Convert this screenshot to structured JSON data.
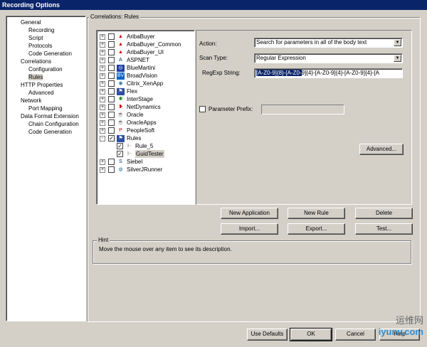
{
  "window": {
    "title": "Recording Options"
  },
  "nav": [
    {
      "label": "General",
      "level": 1
    },
    {
      "label": "Recording",
      "level": 2
    },
    {
      "label": "Script",
      "level": 2
    },
    {
      "label": "Protocols",
      "level": 2
    },
    {
      "label": "Code Generation",
      "level": 2
    },
    {
      "label": "Correlations",
      "level": 1
    },
    {
      "label": "Configuration",
      "level": 2
    },
    {
      "label": "Rules",
      "level": 2,
      "selected": true
    },
    {
      "label": "HTTP Properties",
      "level": 1
    },
    {
      "label": "Advanced",
      "level": 2
    },
    {
      "label": "Network",
      "level": 1
    },
    {
      "label": "Port Mapping",
      "level": 2
    },
    {
      "label": "Data Format Extension",
      "level": 1
    },
    {
      "label": "Chain Configuration",
      "level": 2
    },
    {
      "label": "Code Generation",
      "level": 2
    }
  ],
  "group_title": "Correlations: Rules",
  "rules_tree": [
    {
      "label": "AribaBuyer",
      "icon": "ariba-icon",
      "checked": false,
      "expander": "+"
    },
    {
      "label": "AribaBuyer_Common",
      "icon": "ariba-icon",
      "checked": false,
      "expander": "+"
    },
    {
      "label": "AribaBuyer_UI",
      "icon": "ariba-icon",
      "checked": false,
      "expander": "+"
    },
    {
      "label": "ASPNET",
      "icon": "aspnet-icon",
      "checked": false,
      "expander": "+"
    },
    {
      "label": "BlueMartini",
      "icon": "bluemartini-icon",
      "checked": false,
      "expander": "+"
    },
    {
      "label": "BroadVision",
      "icon": "broadvision-icon",
      "checked": false,
      "expander": "+"
    },
    {
      "label": "Citrix_XenApp",
      "icon": "citrix-icon",
      "checked": false,
      "expander": "+"
    },
    {
      "label": "Flex",
      "icon": "flex-icon",
      "checked": false,
      "expander": "+"
    },
    {
      "label": "InterStage",
      "icon": "interstage-icon",
      "checked": false,
      "expander": "+"
    },
    {
      "label": "NetDynamics",
      "icon": "netdynamics-icon",
      "checked": false,
      "expander": "+"
    },
    {
      "label": "Oracle",
      "icon": "oracle-icon",
      "checked": false,
      "expander": "+"
    },
    {
      "label": "OracleApps",
      "icon": "oracle-icon",
      "checked": false,
      "expander": "+"
    },
    {
      "label": "PeopleSoft",
      "icon": "peoplesoft-icon",
      "checked": false,
      "expander": "+"
    },
    {
      "label": "Rules",
      "icon": "rules-icon",
      "checked": true,
      "expander": "-"
    },
    {
      "label": "Rule_5",
      "icon": "rule-icon",
      "checked": true,
      "child": true
    },
    {
      "label": "GuidTester",
      "icon": "rule-icon",
      "checked": true,
      "child": true,
      "selected": true
    },
    {
      "label": "Siebel",
      "icon": "siebel-icon",
      "checked": false,
      "expander": "+"
    },
    {
      "label": "SilverJRunner",
      "icon": "silverjrunner-icon",
      "checked": false,
      "expander": "+"
    }
  ],
  "form": {
    "action_label": "Action:",
    "action_value": "Search for parameters in all of the body text",
    "scan_label": "Scan Type:",
    "scan_value": "Regular Expression",
    "regexp_label": "RegExp String:",
    "regexp_selected": "[A-Z0-9]{8}-[A-Z0-",
    "regexp_rest": "9]{4}-[A-Z0-9]{4}-[A-Z0-9]{4}-[A",
    "prefix_label": "Parameter Prefix:",
    "prefix_value": "",
    "advanced": "Advanced..."
  },
  "buttons": {
    "new_application": "New Application",
    "new_rule": "New Rule",
    "delete": "Delete",
    "import": "Import...",
    "export": "Export...",
    "test": "Test..."
  },
  "hint": {
    "title": "Hint",
    "text": "Move the mouse over any item to see its description."
  },
  "footer": {
    "use_defaults": "Use Defaults",
    "ok": "OK",
    "cancel": "Cancel",
    "help": "Help"
  },
  "watermark": {
    "text": "运维网",
    "site": "iyunv.com"
  }
}
